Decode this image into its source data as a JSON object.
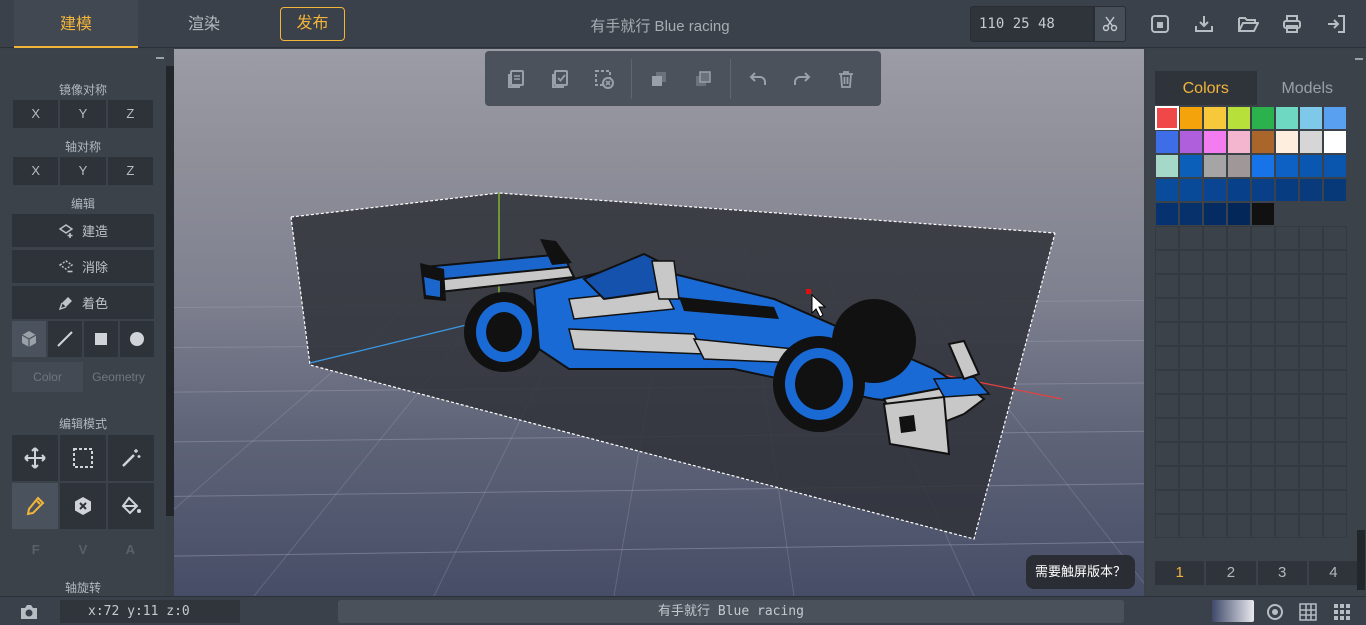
{
  "header": {
    "tabs": [
      {
        "label": "建模",
        "active": true
      },
      {
        "label": "渲染",
        "active": false
      }
    ],
    "publish_label": "发布",
    "title": "有手就行 Blue racing",
    "dimensions": "110 25 48",
    "icons": [
      "save-icon",
      "download-icon",
      "open-folder-icon",
      "print-icon",
      "exit-icon"
    ]
  },
  "left_panel": {
    "mirror_label": "镜像对称",
    "axis_label": "轴对称",
    "edit_label": "编辑",
    "axes": [
      "X",
      "Y",
      "Z"
    ],
    "build_label": "建造",
    "erase_label": "消除",
    "paint_label": "着色",
    "color_tab": "Color",
    "geometry_tab": "Geometry",
    "edit_mode_label": "编辑模式",
    "fva": [
      "F",
      "V",
      "A"
    ],
    "rotate_label": "轴旋转"
  },
  "viewport": {
    "touch_button": "需要触屏版本？"
  },
  "right_panel": {
    "tabs": [
      {
        "label": "Colors",
        "active": true
      },
      {
        "label": "Models",
        "active": false
      }
    ],
    "palette": [
      "#f04848",
      "#f5a30a",
      "#f7c93a",
      "#b7e13a",
      "#2bb24c",
      "#6fd8c2",
      "#7ec9ea",
      "#5aa0f0",
      "#3d6ee8",
      "#b05fdc",
      "#f27cf0",
      "#f4b5cf",
      "#a9652a",
      "#fdeede",
      "#d6d6d6",
      "#ffffff",
      "#a6d8c9",
      "#0b5fb8",
      "#a5a5a5",
      "#a09898",
      "#1674e8",
      "#0d60c4",
      "#0a57b2",
      "#0a55ad",
      "#0a4c9c",
      "#094a98",
      "#094592",
      "#08418a",
      "#083f86",
      "#083c80",
      "#083a7c",
      "#073877",
      "#063370",
      "#06316a",
      "#052c62",
      "#04275a",
      "#111111",
      "#3c424a",
      "#3c424a",
      "#3c424a"
    ],
    "pages": [
      "1",
      "2",
      "3",
      "4"
    ]
  },
  "footer": {
    "coordinates": "x:72  y:11  z:0",
    "status": "有手就行 Blue racing"
  }
}
